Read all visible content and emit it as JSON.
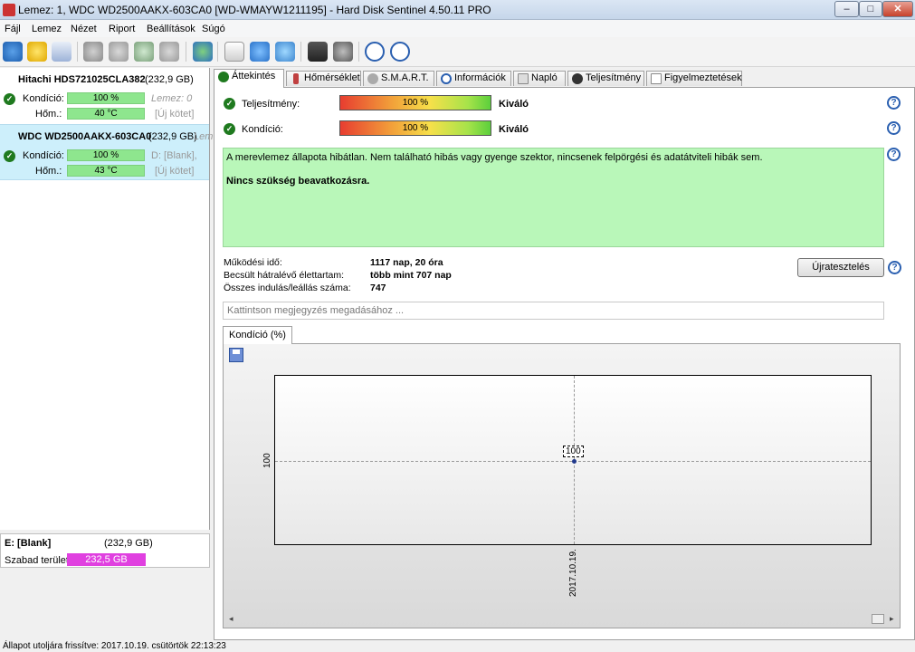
{
  "window": {
    "title": "Lemez: 1, WDC WD2500AAKX-603CA0 [WD-WMAYW1211195]  -  Hard Disk Sentinel 4.50.11 PRO",
    "min_glyph": "–",
    "max_glyph": "□",
    "close_glyph": "✕"
  },
  "menu": {
    "items": [
      "Fájl",
      "Lemez",
      "Nézet",
      "Riport",
      "Beállítások",
      "Súgó"
    ]
  },
  "toolbar": {
    "icons": [
      "refresh-icon",
      "warning-icon",
      "disk-icon",
      "tool-icon-1",
      "tool-icon-2",
      "tool-icon-3",
      "tool-icon-4",
      "globe-icon",
      "document-icon",
      "sync-icon",
      "network-icon",
      "report-icon",
      "speaker-icon",
      "help-icon",
      "info-icon"
    ]
  },
  "disks": [
    {
      "name": "Hitachi HDS721025CLA382",
      "size": "(232,9 GB)",
      "condition_label": "Kondíció:",
      "condition_value": "100 %",
      "condition_note": "Lemez: 0",
      "temp_label": "Hőm.:",
      "temp_value": "40 °C",
      "temp_note": "[Új kötet]"
    },
    {
      "name": "WDC WD2500AAKX-603CA0",
      "size": "(232,9 GB)",
      "size_note": "Lem",
      "condition_label": "Kondíció:",
      "condition_value": "100 %",
      "condition_note": "D: [Blank],",
      "temp_label": "Hőm.:",
      "temp_value": "43 °C",
      "temp_note": "[Új kötet]"
    }
  ],
  "volume": {
    "name": "E: [Blank]",
    "size": "(232,9 GB)",
    "free_label": "Szabad terület",
    "free_value": "232,5 GB"
  },
  "tabs": [
    "Áttekintés",
    "Hőmérséklet",
    "S.M.A.R.T.",
    "Információk",
    "Napló",
    "Teljesítmény",
    "Figyelmeztetések"
  ],
  "overview": {
    "performance_label": "Teljesítmény:",
    "performance_value": "100 %",
    "performance_rating": "Kiváló",
    "condition_label": "Kondíció:",
    "condition_value": "100 %",
    "condition_rating": "Kiváló",
    "message": "A merevlemez állapota hibátlan. Nem található hibás vagy gyenge szektor, nincsenek felpörgési és adatátviteli hibák sem.",
    "action": "Nincs szükség beavatkozásra.",
    "uptime_label": "Működési idő:",
    "uptime_value": "1117 nap, 20 óra",
    "remaining_label": "Becsült hátralévő élettartam:",
    "remaining_value": "több mint 707 nap",
    "starts_label": "Összes indulás/leállás száma:",
    "starts_value": "747",
    "retest_button": "Újratesztelés",
    "comment_placeholder": "Kattintson megjegyzés megadásához ..."
  },
  "chart_tab": "Kondíció  (%)",
  "chart_data": {
    "type": "line",
    "x": [
      "2017.10.19."
    ],
    "series": [
      {
        "values": [
          100
        ]
      }
    ],
    "ytick_labels": [
      "100"
    ],
    "xtick_labels": [
      "2017.10.19."
    ],
    "data_labels": [
      "100"
    ],
    "grid": true
  },
  "scroll": {
    "left_glyph": "◂",
    "right_glyph": "▸"
  },
  "status": {
    "text": "Állapot utoljára frissítve: 2017.10.19. csütörtök 22:13:23"
  },
  "colors": {
    "ok_green": "#1f7a1f",
    "message_bg": "#b9f7b9",
    "free_space_magenta": "#e040e0",
    "selected_disk_bg": "#cdeffb"
  }
}
